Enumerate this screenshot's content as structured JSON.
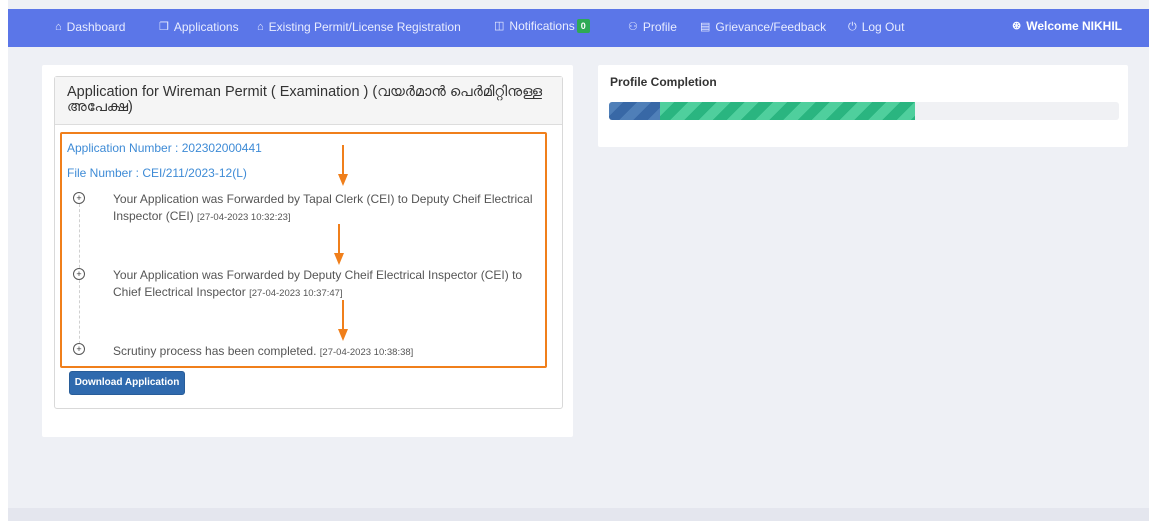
{
  "nav": {
    "items": [
      {
        "icon": "home-icon",
        "glyph": "⌂",
        "label": "Dashboard"
      },
      {
        "icon": "copy-icon",
        "glyph": "❐",
        "label": "Applications"
      },
      {
        "icon": "home-icon",
        "glyph": "⌂",
        "label": "Existing Permit/License Registration"
      },
      {
        "icon": "window-icon",
        "glyph": "◫",
        "label": "Notifications"
      },
      {
        "icon": "user-icon",
        "glyph": "⚇",
        "label": "Profile"
      },
      {
        "icon": "document-icon",
        "glyph": "▤",
        "label": "Grievance/Feedback"
      },
      {
        "icon": "power-icon",
        "glyph": "⏻",
        "label": "Log Out"
      }
    ],
    "notifications_count": "0",
    "welcome": "Welcome NIKHIL",
    "welcome_glyph": "⊛",
    "accent_color": "#5b76e8"
  },
  "application": {
    "title": "Application for Wireman Permit ( Examination ) (വയർമാൻ പെർമിറ്റിനുള്ള അപേക്ഷ)",
    "application_number": "Application Number : 202302000441",
    "file_number": "File Number : CEI/211/2023-12(L)",
    "timeline": [
      {
        "text": "Your Application was Forwarded by Tapal Clerk (CEI) to Deputy Cheif Electrical Inspector (CEI)",
        "date": "[27-04-2023 10:32:23]"
      },
      {
        "text": "Your Application was Forwarded by Deputy Cheif Electrical Inspector (CEI) to Chief Electrical Inspector",
        "date": "[27-04-2023 10:37:47]"
      },
      {
        "text": "Scrutiny process has been completed.",
        "date": "[27-04-2023 10:38:38]"
      }
    ],
    "download_label": "Download Application",
    "highlight_color": "#f07f1b"
  },
  "profile": {
    "title": "Profile Completion",
    "progress_segments": [
      0.1,
      0.5
    ]
  }
}
